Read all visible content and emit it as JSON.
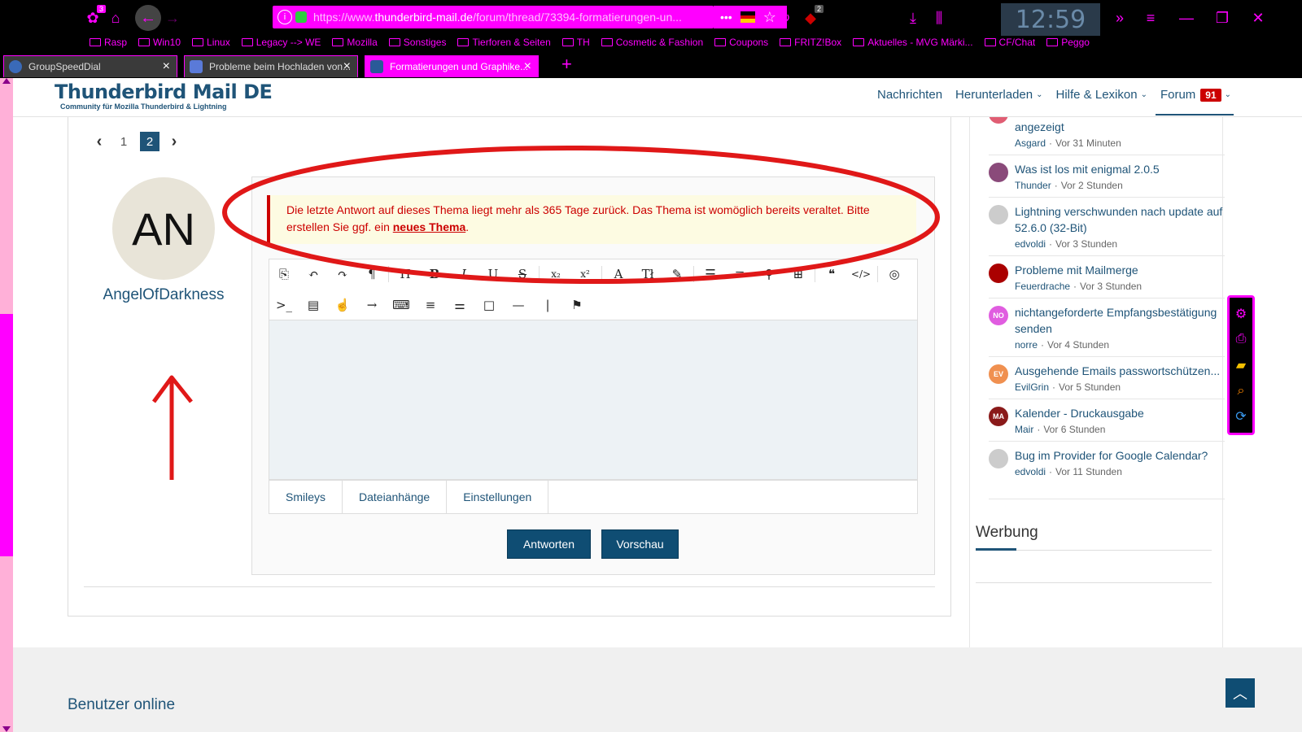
{
  "browser": {
    "url_base": "https://www.",
    "url_domain": "thunderbird-mail.de",
    "url_path": "/forum/thread/73394-formatierungen-un...",
    "url_menu_glyph": "•••",
    "clock": "12:59",
    "addon_badge_count": "3",
    "ublock_badge_count": "2",
    "bookmarks": [
      "Rasp",
      "Win10",
      "Linux",
      "Legacy --> WE",
      "Mozilla",
      "Sonstiges",
      "Tierforen & Seiten",
      "TH",
      "Cosmetic & Fashion",
      "Coupons",
      "FRITZ!Box",
      "Aktuelles - MVG Märki...",
      "CF/Chat",
      "Peggo"
    ],
    "tabs": [
      {
        "label": "GroupSpeedDial",
        "active": false
      },
      {
        "label": "Probleme beim Hochladen von...",
        "active": false
      },
      {
        "label": "Formatierungen und Graphike...",
        "active": true
      }
    ],
    "new_tab_glyph": "+",
    "tab_close_glyph": "×",
    "colors": {
      "accent": "#ff00ff",
      "chrome_bg": "#000000"
    }
  },
  "site": {
    "title": "Thunderbird Mail DE",
    "subtitle": "Community für Mozilla Thunderbird & Lightning",
    "nav": [
      {
        "label": "Nachrichten",
        "dropdown": false
      },
      {
        "label": "Herunterladen",
        "dropdown": true
      },
      {
        "label": "Hilfe & Lexikon",
        "dropdown": true
      },
      {
        "label": "Forum",
        "dropdown": true,
        "badge": "91"
      }
    ],
    "caret_glyph": "⌄",
    "colors": {
      "brand": "#1f5478",
      "badge": "#cc0000",
      "button": "#0f4d73"
    }
  },
  "thread": {
    "pagination": {
      "prev": "‹",
      "next": "›",
      "pages": [
        "1",
        "2"
      ],
      "current": "2"
    },
    "user": {
      "initials": "AN",
      "name": "AngelOfDarkness"
    },
    "warning": {
      "text": "Die letzte Antwort auf dieses Thema liegt mehr als 365 Tage zurück. Das Thema ist womöglich bereits veraltet. Bitte erstellen Sie ggf. ein",
      "link": "neues Thema",
      "suffix": "."
    },
    "toolbar_row1": [
      "source-icon",
      "undo-icon",
      "redo-icon",
      "paragraph-icon",
      "heading-icon",
      "bold-icon",
      "italic-icon",
      "underline-icon",
      "strikethrough-icon",
      "subscript-icon",
      "superscript-icon",
      "font-icon",
      "font-size-icon",
      "color-icon",
      "list-icon",
      "align-icon",
      "link-icon",
      "table-icon",
      "quote-icon",
      "code-icon",
      "spoiler-icon"
    ],
    "toolbar_row2": [
      "terminal-icon",
      "book-icon",
      "hand-icon",
      "arrow-icon",
      "keyboard-icon",
      "menu-icon",
      "sliders-icon",
      "box-icon",
      "hr-icon",
      "line-icon",
      "flag-icon"
    ],
    "editor_tabs": [
      "Smileys",
      "Dateianhänge",
      "Einstellungen"
    ],
    "buttons": {
      "reply": "Antworten",
      "preview": "Vorschau"
    }
  },
  "sidebar": {
    "items": [
      {
        "title": "Anhänge werden sporadisch nicht angezeigt",
        "author": "Asgard",
        "time": "Vor 31 Minuten",
        "avatar": "AS",
        "color": "#e05d73"
      },
      {
        "title": "Was ist los mit enigmal 2.0.5",
        "author": "Thunder",
        "time": "Vor 2 Stunden",
        "avatar": "",
        "color": "#8a4a7a"
      },
      {
        "title": "Lightning verschwunden nach update auf 52.6.0 (32-Bit)",
        "author": "edvoldi",
        "time": "Vor 3 Stunden",
        "avatar": "",
        "color": "#cccccc"
      },
      {
        "title": "Probleme mit Mailmerge",
        "author": "Feuerdrache",
        "time": "Vor 3 Stunden",
        "avatar": "",
        "color": "#aa0000"
      },
      {
        "title": "nichtangeforderte Empfangsbestätigung senden",
        "author": "norre",
        "time": "Vor 4 Stunden",
        "avatar": "NO",
        "color": "#e05de0"
      },
      {
        "title": "Ausgehende Emails passwortschützen...",
        "author": "EvilGrin",
        "time": "Vor 5 Stunden",
        "avatar": "EV",
        "color": "#f09050"
      },
      {
        "title": "Kalender - Druckausgabe",
        "author": "Mair",
        "time": "Vor 6 Stunden",
        "avatar": "MA",
        "color": "#8a1a1a"
      },
      {
        "title": "Bug im Provider for Google Calendar?",
        "author": "edvoldi",
        "time": "Vor 11 Stunden",
        "avatar": "",
        "color": "#cccccc"
      }
    ],
    "meta_sep": "·",
    "werbung": "Werbung"
  },
  "footer": {
    "users_online": "Benutzer online"
  },
  "annotation": {
    "color": "#e01818"
  }
}
